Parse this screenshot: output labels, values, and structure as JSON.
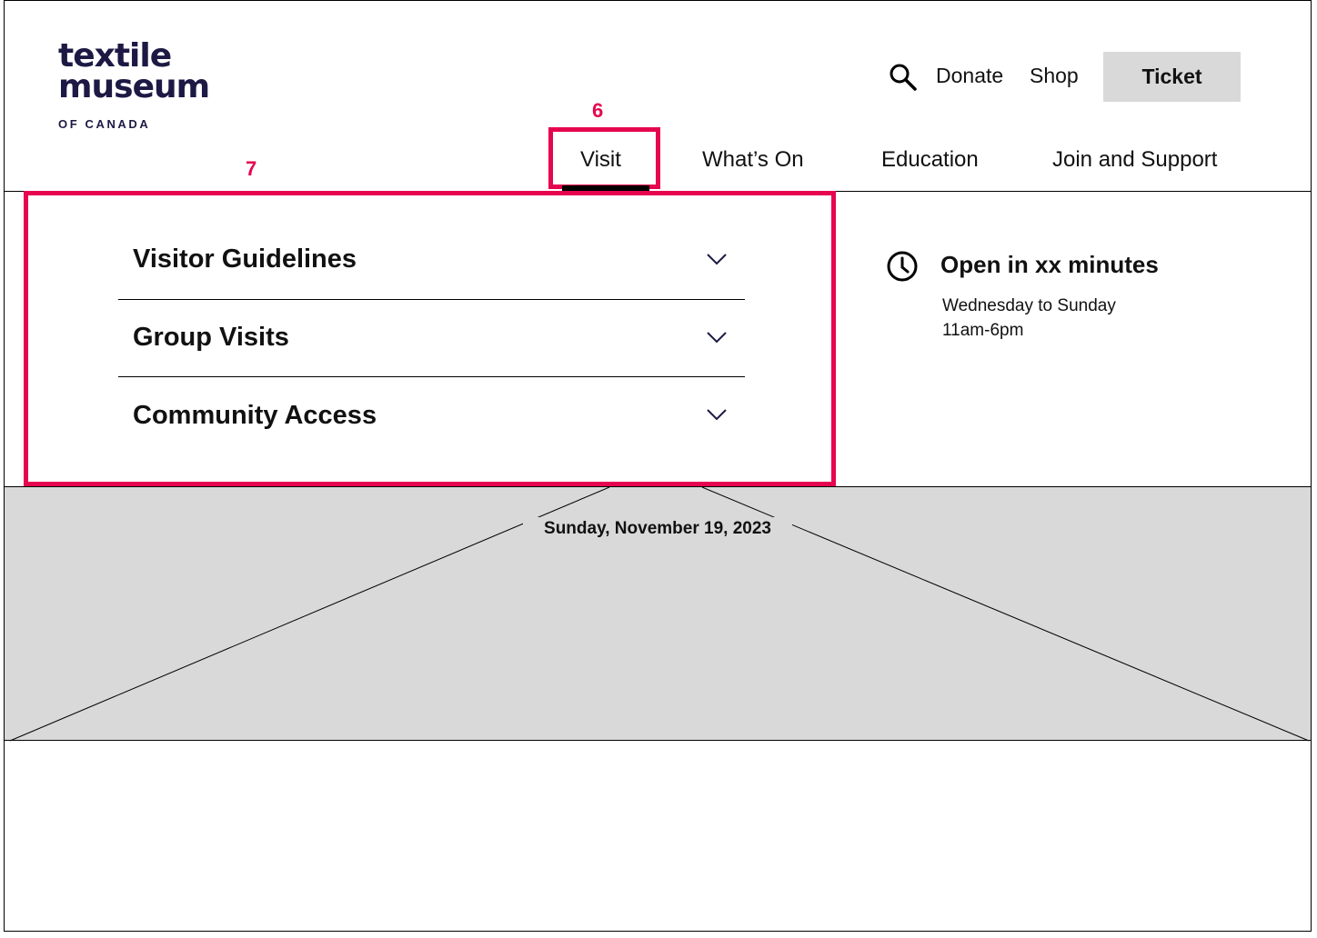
{
  "logo": {
    "line1": "textile",
    "line2": "museum",
    "line3": "OF CANADA"
  },
  "utility_nav": {
    "search_icon": "search-icon",
    "donate": "Donate",
    "shop": "Shop",
    "ticket": "Ticket"
  },
  "main_nav": {
    "items": [
      "Visit",
      "What’s On",
      "Education",
      "Join and Support"
    ],
    "active": "Visit"
  },
  "annotations": {
    "nav_marker": "6",
    "dropdown_marker": "7",
    "color": "#e6054f"
  },
  "dropdown": {
    "items": [
      {
        "label": "Visitor Guidelines",
        "icon": "chevron-down-icon"
      },
      {
        "label": "Group Visits",
        "icon": "chevron-down-icon"
      },
      {
        "label": "Community Access",
        "icon": "chevron-down-icon"
      }
    ]
  },
  "hours": {
    "icon": "clock-icon",
    "status": "Open in xx minutes",
    "days": "Wednesday to Sunday",
    "time": "11am-6pm"
  },
  "hero": {
    "date": "Sunday, November 19, 2023",
    "placeholder_fill": "#d9d9d9"
  },
  "colors": {
    "brand": "#1c1a44",
    "annotation": "#e6054f",
    "button_bg": "#d9d9d9"
  }
}
